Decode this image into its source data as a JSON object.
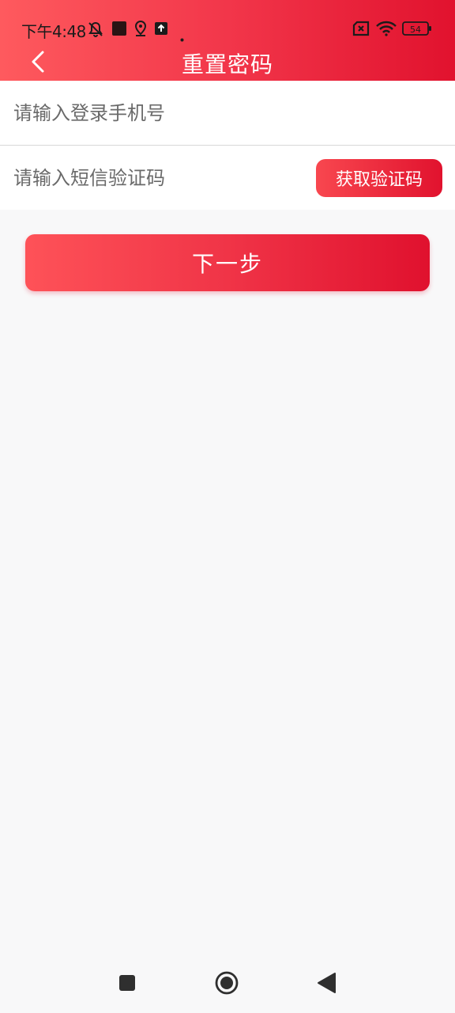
{
  "status_bar": {
    "time": "下午4:48",
    "battery": "54",
    "icons": [
      "mute-icon",
      "app-icon",
      "location-icon",
      "upload-icon",
      "dot-icon",
      "sim-off-icon",
      "wifi-icon",
      "battery-icon"
    ]
  },
  "header": {
    "title": "重置密码",
    "back_icon": "chevron-left-icon"
  },
  "form": {
    "phone_placeholder": "请输入登录手机号",
    "phone_value": "",
    "code_placeholder": "请输入短信验证码",
    "code_value": "",
    "get_code_label": "获取验证码"
  },
  "next_label": "下一步",
  "nav_bar": {
    "icons": [
      "square-icon",
      "home-circle-icon",
      "back-triangle-icon"
    ]
  },
  "colors": {
    "accent_start": "#fe5a5e",
    "accent_end": "#e1122e",
    "background": "#f8f8f9"
  }
}
